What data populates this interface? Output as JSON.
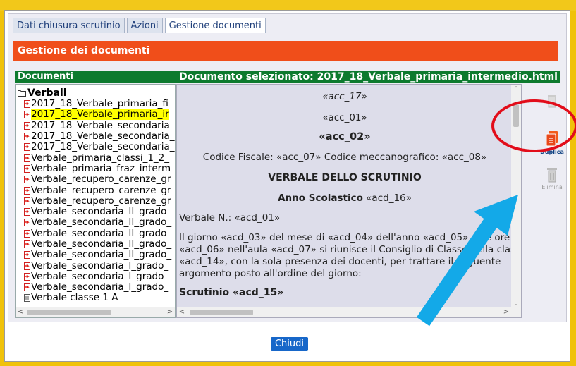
{
  "tabs": [
    {
      "label": "Dati chiusura scrutinio"
    },
    {
      "label": "Azioni"
    },
    {
      "label": "Gestione documenti"
    }
  ],
  "section_title": "Gestione dei documenti",
  "documents_header": "Documenti",
  "selected_header": "Documento selezionato: 2017_18_Verbale_primaria_intermedio.html",
  "tree": {
    "root": "Verbali",
    "items": [
      {
        "label": "2017_18_Verbale_primaria_fi"
      },
      {
        "label": "2017_18_Verbale_primaria_ir"
      },
      {
        "label": "2017_18_Verbale_secondaria_"
      },
      {
        "label": "2017_18_Verbale_secondaria_"
      },
      {
        "label": "2017_18_Verbale_secondaria_"
      },
      {
        "label": "Verbale_primaria_classi_1_2_"
      },
      {
        "label": "Verbale_primaria_fraz_interm"
      },
      {
        "label": "Verbale_recupero_carenze_gr"
      },
      {
        "label": "Verbale_recupero_carenze_gr"
      },
      {
        "label": "Verbale_recupero_carenze_gr"
      },
      {
        "label": "Verbale_secondaria_II_grado_"
      },
      {
        "label": "Verbale_secondaria_II_grado_"
      },
      {
        "label": "Verbale_secondaria_II_grado_"
      },
      {
        "label": "Verbale_secondaria_II_grado_"
      },
      {
        "label": "Verbale_secondaria_II_grado_"
      },
      {
        "label": "Verbale_secondaria_I_grado_"
      },
      {
        "label": "Verbale_secondaria_I_grado_"
      },
      {
        "label": "Verbale_secondaria_I_grado_"
      },
      {
        "label": "Verbale classe 1 A"
      }
    ]
  },
  "document": {
    "acc17": "«acc_17»",
    "acc01": "«acc_01»",
    "acc02": "«acc_02»",
    "codice": "Codice Fiscale: «acc_07» Codice meccanografico: «acc_08»",
    "verbale_title": "VERBALE DELLO SCRUTINIO",
    "anno_label": "Anno Scolastico",
    "anno_value": "«acd_16»",
    "verbale_n": "Verbale N.: «acd_01»",
    "para1": "Il giorno «acd_03» del mese di «acd_04» dell'anno «acd_05», alle ore",
    "para2": "«acd_06» nell'aula «acd_07» si riunisce il Consiglio di Classe della classe",
    "para3": "«acd_14», con la sola presenza dei docenti, per trattare il seguente",
    "para4": "argomento posto all'ordine del giorno:",
    "scrutinio": "Scrutinio «acd_15»"
  },
  "tools": {
    "duplica": "Duplica",
    "elimina": "Elimina"
  },
  "close_label": "Chiudi",
  "colors": {
    "accent_orange": "#f04e1a",
    "header_green": "#0d7a2e",
    "button_blue": "#1767c9",
    "highlight_yellow": "#ffff00",
    "annotation_red": "#e20d1a",
    "annotation_arrow": "#13a9e8"
  }
}
